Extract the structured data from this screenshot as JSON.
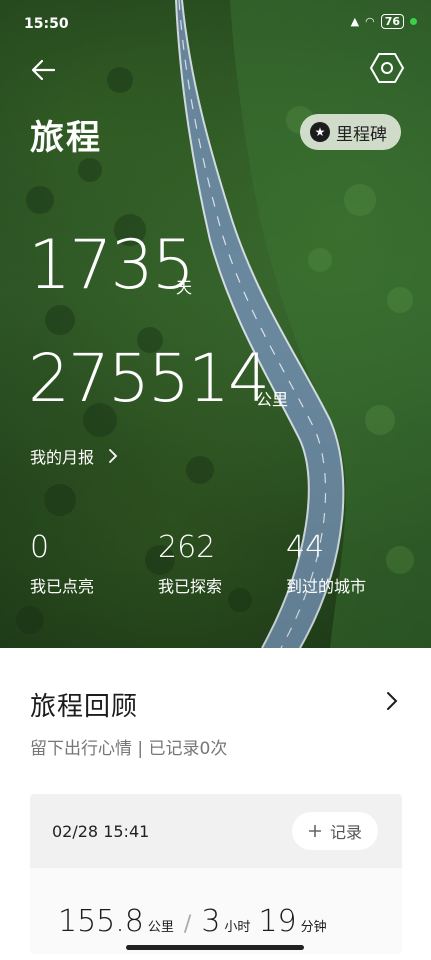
{
  "status_bar": {
    "time": "15:50",
    "battery": "76"
  },
  "header": {
    "title": "旅程",
    "milestone_label": "里程碑"
  },
  "stats": {
    "days_value": "1735",
    "days_unit": "天",
    "distance_value": "275514",
    "distance_unit": "公里",
    "monthly_report_label": "我的月报"
  },
  "counters": [
    {
      "value": "0",
      "label": "我已点亮"
    },
    {
      "value": "262",
      "label": "我已探索"
    },
    {
      "value": "44",
      "label": "到过的城市"
    }
  ],
  "review": {
    "title": "旅程回顾",
    "subtitle": "留下出行心情 | 已记录0次",
    "card": {
      "date": "02/28 15:41",
      "record_label": "记录",
      "distance_value": "155.8",
      "distance_unit": "公里",
      "hours_value": "3",
      "hours_unit": "小时",
      "minutes_value": "19",
      "minutes_unit": "分钟"
    }
  }
}
